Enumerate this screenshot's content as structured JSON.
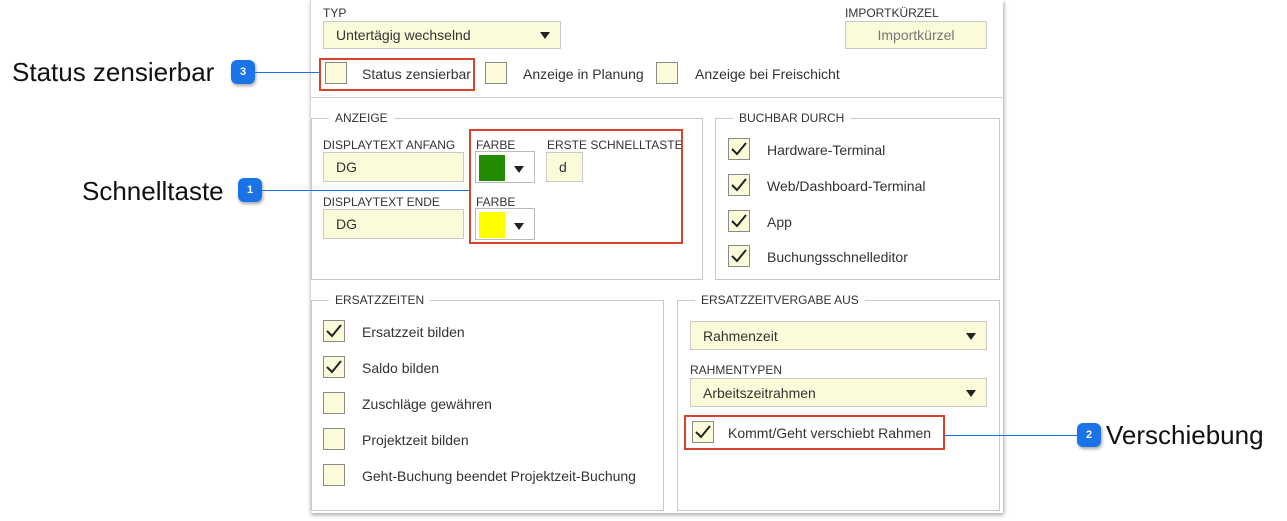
{
  "type_section": {
    "type_label": "TYP",
    "type_value": "Untertägig wechselnd",
    "import_label": "IMPORTKÜRZEL",
    "import_placeholder": "Importkürzel",
    "checkboxes": [
      {
        "label": "Status zensierbar",
        "checked": false
      },
      {
        "label": "Anzeige in Planung",
        "checked": false
      },
      {
        "label": "Anzeige bei Freischicht",
        "checked": false
      }
    ]
  },
  "anzeige": {
    "title": "ANZEIGE",
    "display_start_label": "DISPLAYTEXT ANFANG",
    "display_start_value": "DG",
    "color1_label": "FARBE",
    "color1": "#228b00",
    "hotkey_label": "ERSTE SCHNELLTASTE",
    "hotkey_value": "d",
    "display_end_label": "DISPLAYTEXT ENDE",
    "display_end_value": "DG",
    "color2_label": "FARBE",
    "color2": "#ffff00"
  },
  "buchbar": {
    "title": "BUCHBAR DURCH",
    "items": [
      {
        "label": "Hardware-Terminal",
        "checked": true
      },
      {
        "label": "Web/Dashboard-Terminal",
        "checked": true
      },
      {
        "label": "App",
        "checked": true
      },
      {
        "label": "Buchungsschnelleditor",
        "checked": true
      }
    ]
  },
  "ersatzzeiten": {
    "title": "ERSATZZEITEN",
    "items": [
      {
        "label": "Ersatzzeit bilden",
        "checked": true
      },
      {
        "label": "Saldo bilden",
        "checked": true
      },
      {
        "label": "Zuschläge gewähren",
        "checked": false
      },
      {
        "label": "Projektzeit bilden",
        "checked": false
      },
      {
        "label": "Geht-Buchung beendet Projektzeit-Buchung",
        "checked": false
      }
    ]
  },
  "ersatzvergabe": {
    "title": "ERSATZZEITVERGABE AUS",
    "select_value": "Rahmenzeit",
    "rahmentypen_label": "RAHMENTYPEN",
    "rahmentypen_value": "Arbeitszeitrahmen",
    "kommt_geht": {
      "label": "Kommt/Geht verschiebt Rahmen",
      "checked": true
    }
  },
  "callouts": [
    {
      "number": "1",
      "text": "Schnelltaste"
    },
    {
      "number": "2",
      "text": "Verschiebung"
    },
    {
      "number": "3",
      "text": "Status zensierbar"
    }
  ],
  "colors": {
    "highlight": "#d7442a",
    "badge": "#1a73e8",
    "field_bg": "#fcfbd9"
  }
}
